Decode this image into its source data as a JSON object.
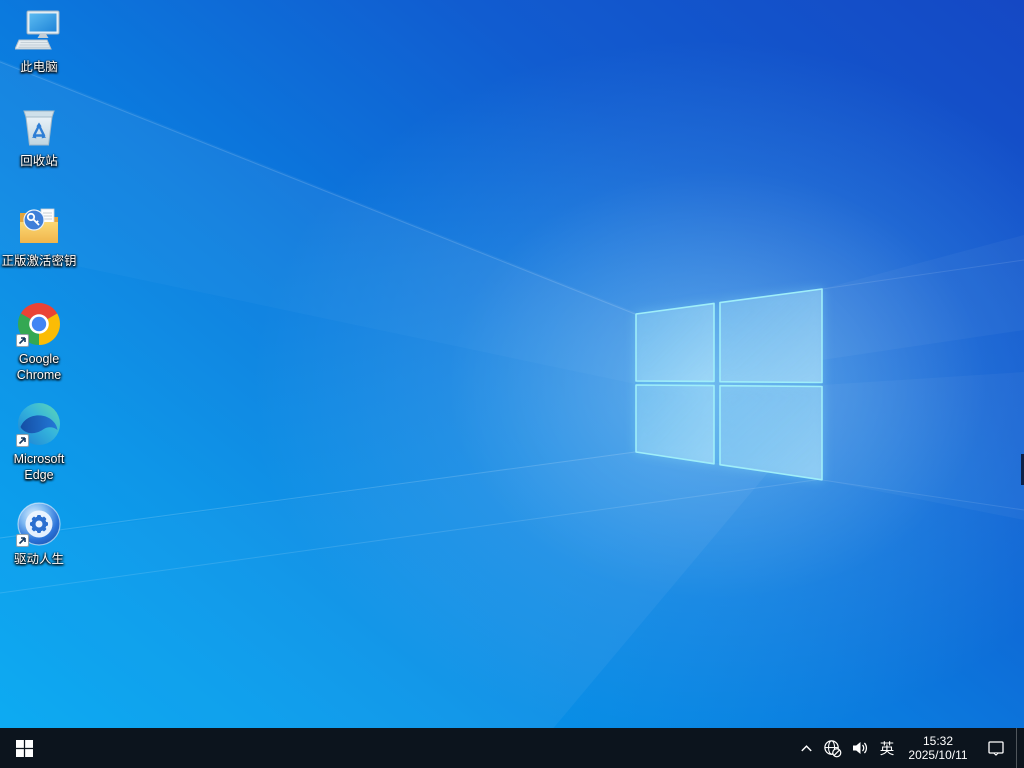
{
  "desktop": {
    "icons": [
      {
        "name": "this-pc",
        "label": "此电脑",
        "shortcut": false
      },
      {
        "name": "recycle-bin",
        "label": "回收站",
        "shortcut": false
      },
      {
        "name": "activation-key-folder",
        "label": "正版激活密钥",
        "shortcut": false
      },
      {
        "name": "google-chrome",
        "lines": [
          "Google",
          "Chrome"
        ],
        "shortcut": true
      },
      {
        "name": "microsoft-edge",
        "lines": [
          "Microsoft",
          "Edge"
        ],
        "shortcut": true
      },
      {
        "name": "driver-life",
        "label": "驱动人生",
        "shortcut": true
      }
    ]
  },
  "taskbar": {
    "start_icon": "windows-logo-icon",
    "tray": {
      "hidden_icons_icon": "chevron-up-icon",
      "network_icon": "globe-no-internet-icon",
      "volume_icon": "speaker-icon",
      "ime_indicator": "英",
      "time": "15:32",
      "date": "2025/10/11",
      "action_center_icon": "notification-bubble-icon"
    }
  },
  "colors": {
    "wallpaper_bright_azure": "#00a9f3",
    "wallpaper_azure": "#0793e8",
    "wallpaper_deep_blue": "#1548c4",
    "logo_pane_stroke": "#9feef9",
    "taskbar_background": "#0c141d",
    "taskbar_foreground": "#ffffff",
    "chrome_red": "#ea4335",
    "chrome_yellow": "#fbbc05",
    "chrome_green": "#34a853",
    "chrome_blue": "#4285f4",
    "edge_teal": "#5fd8b4",
    "edge_blue": "#1659b8",
    "folder_yellow": "#f3bd55",
    "recycle_arrow_blue": "#2e7ed5"
  }
}
